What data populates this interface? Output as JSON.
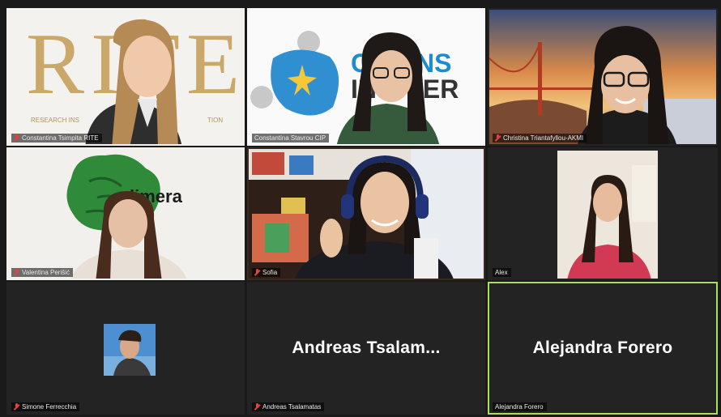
{
  "participants": [
    {
      "name": "Constantina Tsimpita RITE",
      "muted": true,
      "logo": "RITE",
      "logo_sub_left": "RESEARCH INS",
      "logo_sub_right": "TION"
    },
    {
      "name": "Constantina Stavrou CIP",
      "muted": false,
      "logo_line1": "CI   ENS",
      "logo_line2": "IN    VER"
    },
    {
      "name": "Christina Triantafyllou-AKMI",
      "muted": true
    },
    {
      "name": "Valentina Perišić",
      "muted": true,
      "logo": "limera"
    },
    {
      "name": "Sofia",
      "muted": true
    },
    {
      "name": "Alex",
      "muted": false
    },
    {
      "name": "Simone Ferrecchia",
      "muted": true
    },
    {
      "name": "Andreas Tsalamatas",
      "muted": true,
      "display_name": "Andreas  Tsalam..."
    },
    {
      "name": "Alejandra Forero",
      "muted": false,
      "display_name": "Alejandra Forero",
      "active": true
    }
  ],
  "colors": {
    "active_speaker_border": "#a8e05a",
    "muted_mic": "#e24242",
    "tile_bg": "#232323"
  }
}
